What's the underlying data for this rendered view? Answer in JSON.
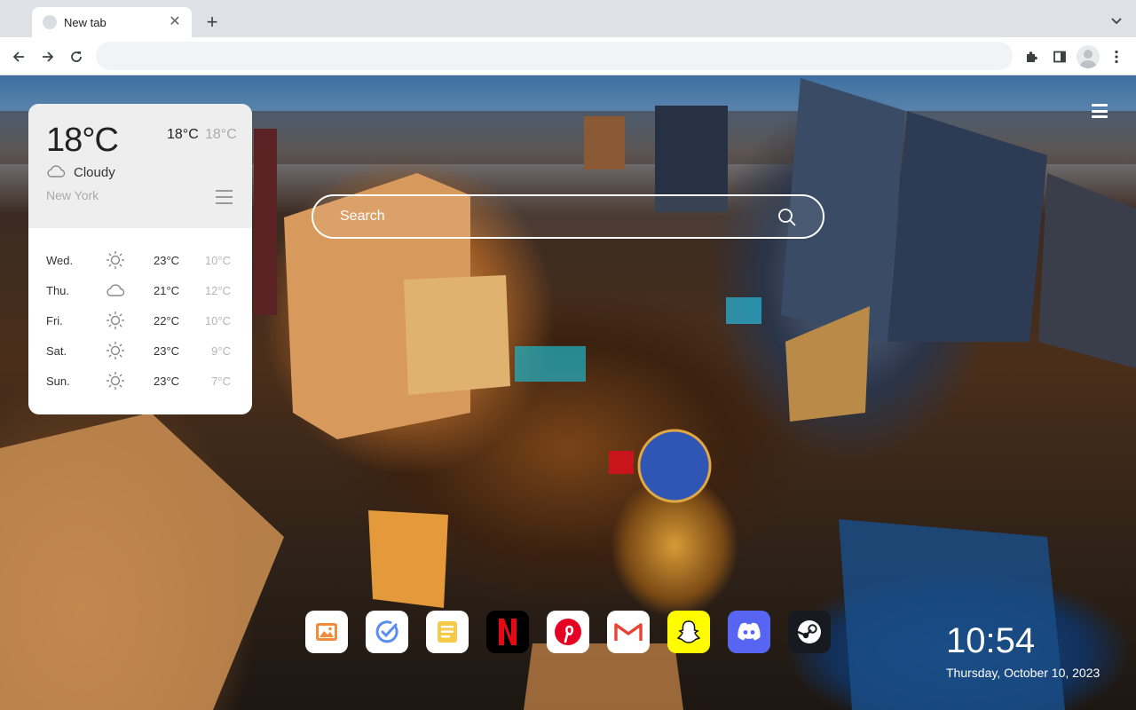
{
  "browser": {
    "tab_title": "New tab",
    "tab_close": "✕",
    "new_tab": "+",
    "address_value": "",
    "address_placeholder": ""
  },
  "weather": {
    "current_temp": "18°C",
    "today_high": "18°C",
    "today_low": "18°C",
    "condition": "Cloudy",
    "condition_icon": "cloud-icon",
    "city": "New York",
    "forecast": [
      {
        "day": "Wed.",
        "icon": "sun-icon",
        "high": "23°C",
        "low": "10°C"
      },
      {
        "day": "Thu.",
        "icon": "cloud-icon",
        "high": "21°C",
        "low": "12°C"
      },
      {
        "day": "Fri.",
        "icon": "sun-icon",
        "high": "22°C",
        "low": "10°C"
      },
      {
        "day": "Sat.",
        "icon": "sun-icon",
        "high": "23°C",
        "low": "9°C"
      },
      {
        "day": "Sun.",
        "icon": "sun-icon",
        "high": "23°C",
        "low": "7°C"
      }
    ]
  },
  "search": {
    "placeholder": "Search",
    "value": ""
  },
  "shortcuts": [
    {
      "name": "photos",
      "icon": "photo-icon",
      "bg": "#ffffff"
    },
    {
      "name": "tasks",
      "icon": "check-icon",
      "bg": "#ffffff"
    },
    {
      "name": "notes",
      "icon": "notes-icon",
      "bg": "#ffffff"
    },
    {
      "name": "netflix",
      "icon": "netflix-icon",
      "bg": "#000000",
      "accent": "#e50914"
    },
    {
      "name": "pinterest",
      "icon": "pinterest-icon",
      "bg": "#ffffff",
      "accent": "#e60023"
    },
    {
      "name": "gmail",
      "icon": "gmail-icon",
      "bg": "#ffffff",
      "accent": "#ea4335"
    },
    {
      "name": "snapchat",
      "icon": "snapchat-icon",
      "bg": "#fffc00"
    },
    {
      "name": "discord",
      "icon": "discord-icon",
      "bg": "#5865f2"
    },
    {
      "name": "steam",
      "icon": "steam-icon",
      "bg": "#171a21"
    }
  ],
  "clock": {
    "time": "10:54",
    "date": "Thursday, October 10, 2023"
  }
}
